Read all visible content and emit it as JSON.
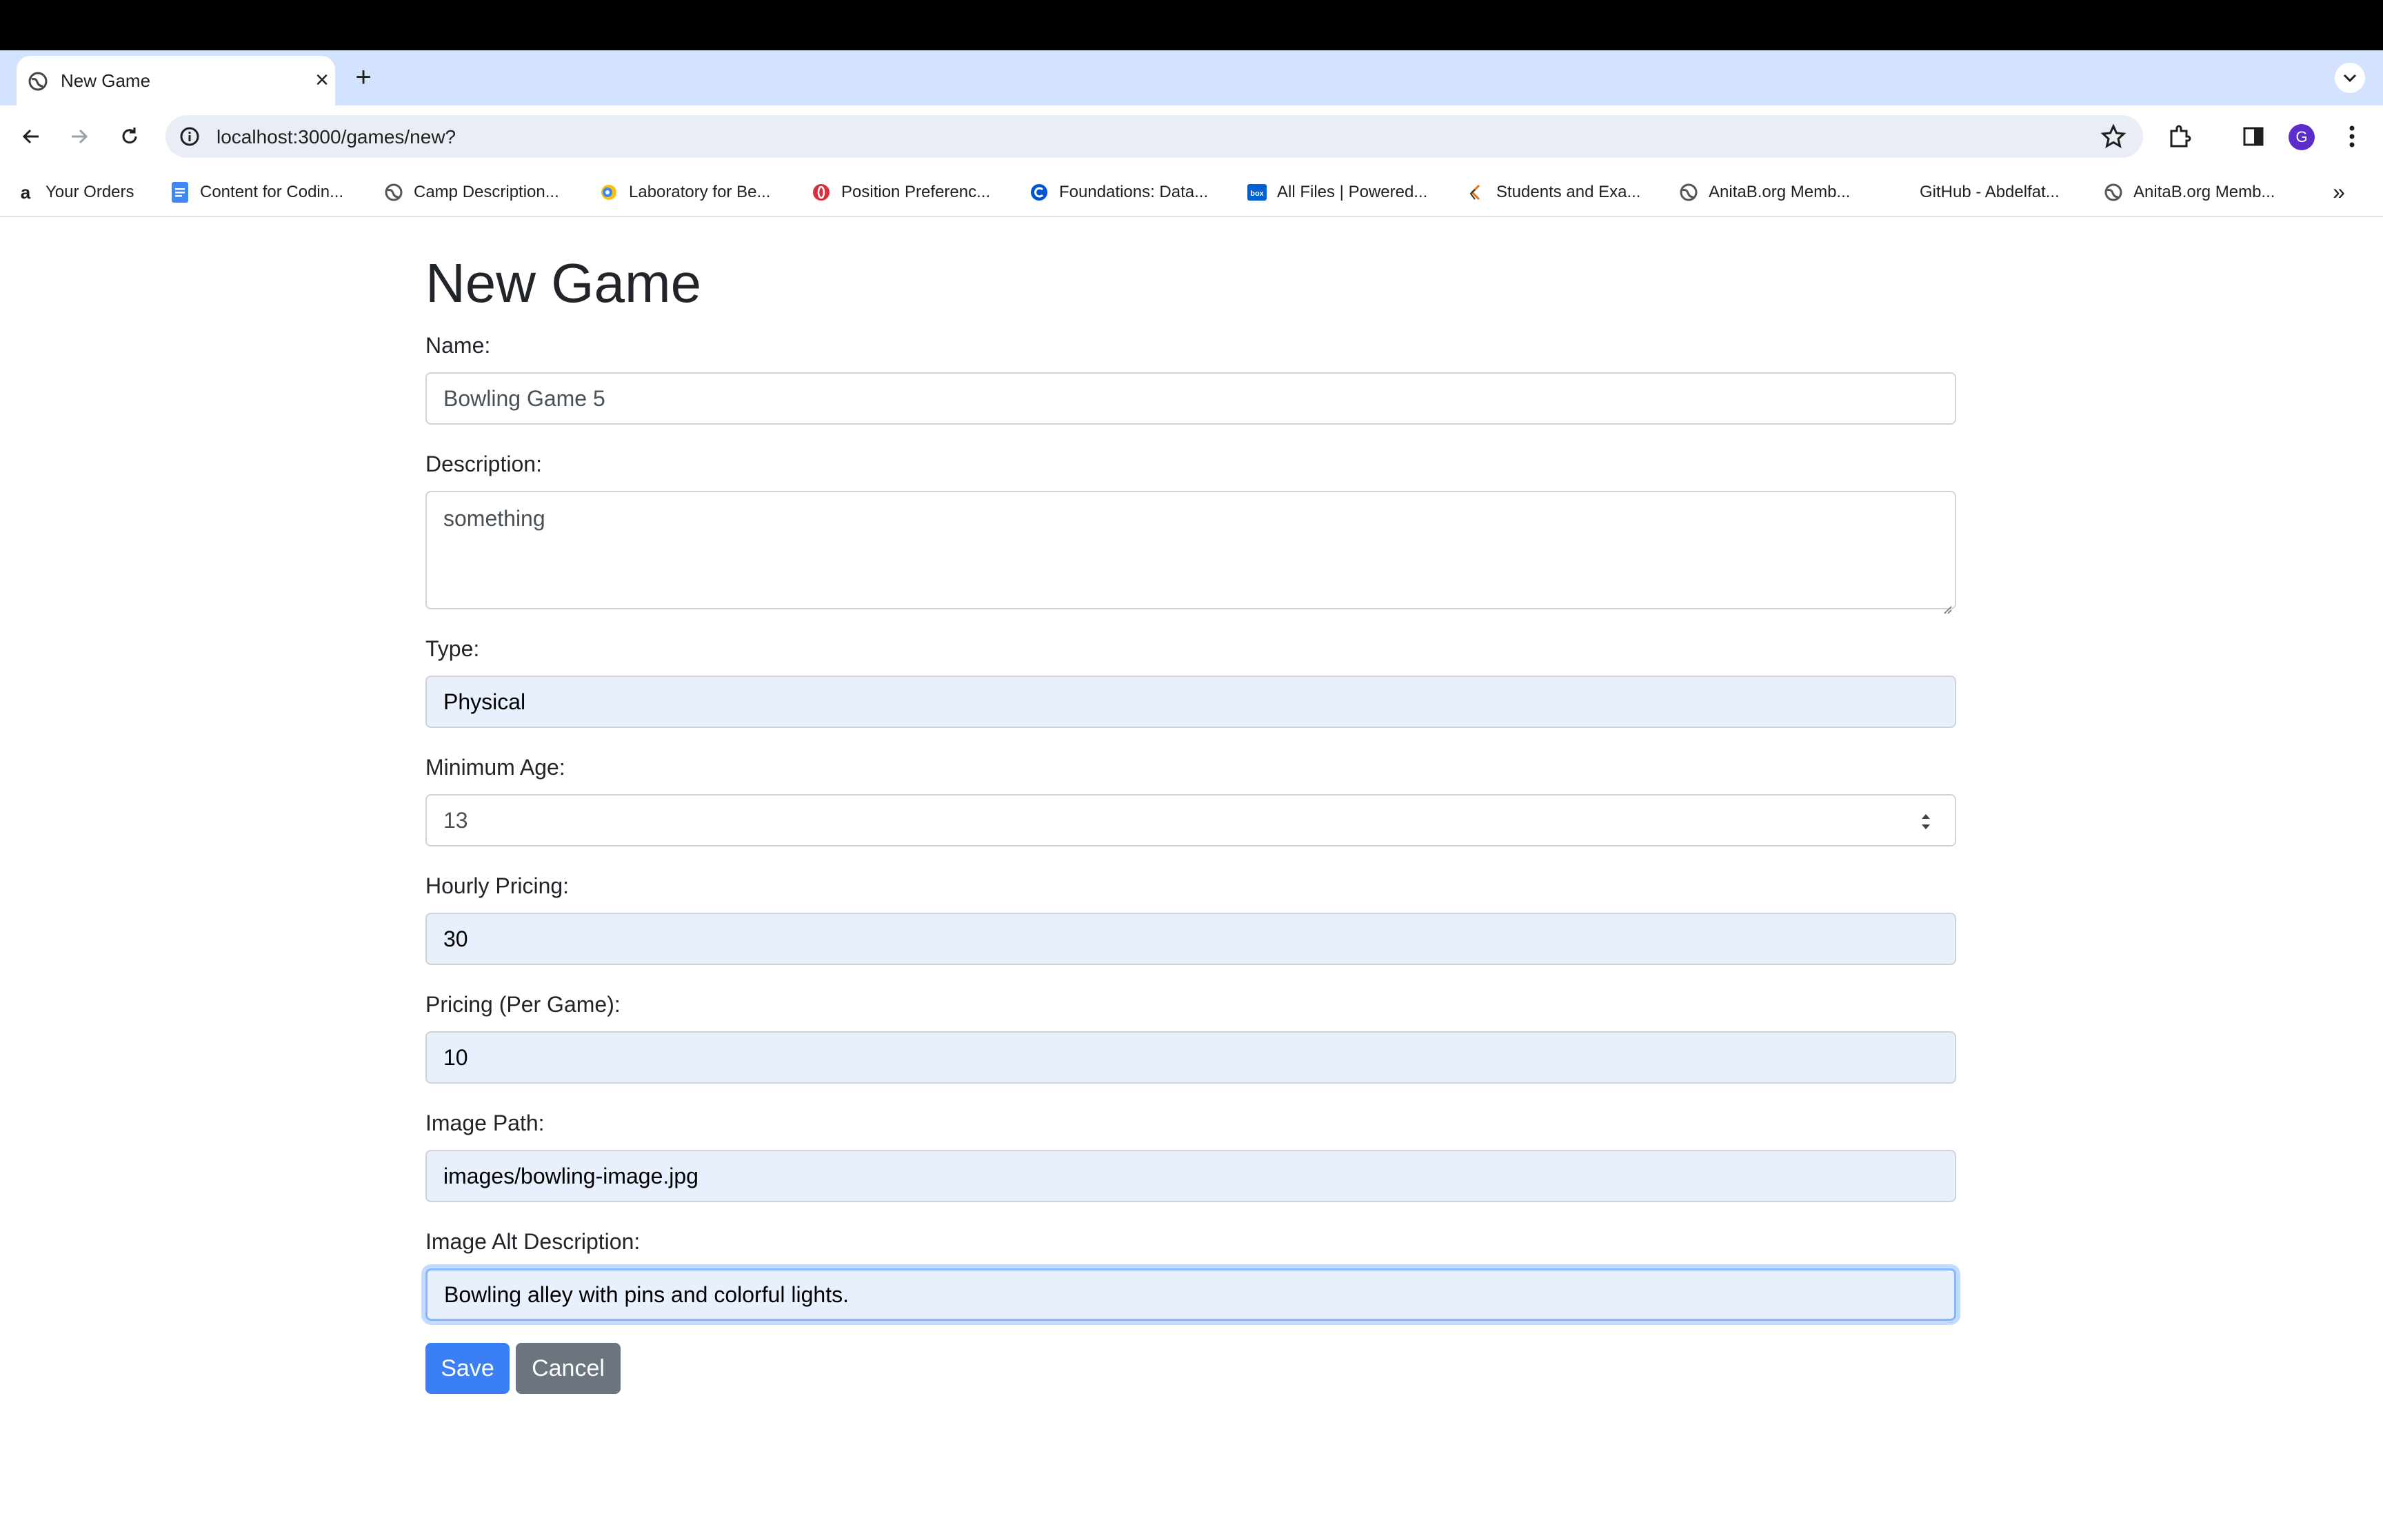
{
  "browser": {
    "tab_title": "New Game",
    "url": "localhost:3000/games/new?",
    "avatar_letter": "G",
    "bookmarks": [
      {
        "label": "Your Orders",
        "icon": "amazon-icon"
      },
      {
        "label": "Content for Codin...",
        "icon": "docs-icon"
      },
      {
        "label": "Camp Description...",
        "icon": "globe-icon"
      },
      {
        "label": "Laboratory for Be...",
        "icon": "lab-icon"
      },
      {
        "label": "Position Preferenc...",
        "icon": "opera-icon"
      },
      {
        "label": "Foundations: Data...",
        "icon": "coursera-icon"
      },
      {
        "label": "All Files | Powered...",
        "icon": "box-icon"
      },
      {
        "label": "Students and Exa...",
        "icon": "students-icon"
      },
      {
        "label": "AnitaB.org Memb...",
        "icon": "globe-icon"
      },
      {
        "label": "GitHub - Abdelfat...",
        "icon": "github-icon"
      },
      {
        "label": "AnitaB.org Memb...",
        "icon": "globe-icon"
      }
    ]
  },
  "form": {
    "title": "New Game",
    "name_label": "Name:",
    "name_value": "Bowling Game 5",
    "description_label": "Description:",
    "description_value": "something",
    "type_label": "Type:",
    "type_value": "Physical",
    "min_age_label": "Minimum Age:",
    "min_age_value": "13",
    "hourly_label": "Hourly Pricing:",
    "hourly_value": "30",
    "per_game_label": "Pricing (Per Game):",
    "per_game_value": "10",
    "image_path_label": "Image Path:",
    "image_path_value": "images/bowling-image.jpg",
    "image_alt_label": "Image Alt Description:",
    "image_alt_value": "Bowling alley with pins and colorful lights.",
    "save_label": "Save",
    "cancel_label": "Cancel"
  },
  "colors": {
    "primary": "#3b7ff5",
    "secondary": "#6c757d",
    "autofill": "#e8f0fe",
    "tabstrip": "#d3e3fd"
  }
}
